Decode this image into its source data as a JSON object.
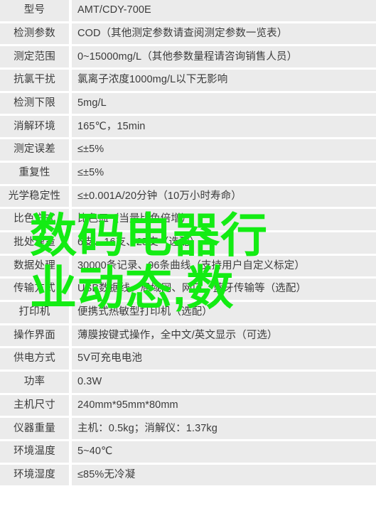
{
  "table": {
    "rows": [
      {
        "label": "型号",
        "value": "AMT/CDY-700E"
      },
      {
        "label": "检测参数",
        "value": "COD（其他测定参数请查阅测定参数一览表）"
      },
      {
        "label": "测定范围",
        "value": "0~15000mg/L（其他参数量程请咨询销售人员）"
      },
      {
        "label": "抗氯干扰",
        "value": "氯离子浓度1000mg/L以下无影响"
      },
      {
        "label": "检测下限",
        "value": "5mg/L"
      },
      {
        "label": "消解环境",
        "value": "165℃，15min"
      },
      {
        "label": "测定误差",
        "value": "≤±5%"
      },
      {
        "label": "重复性",
        "value": "≤±5%"
      },
      {
        "label": "光学稳定性",
        "value": "≤±0.001A/20分钟（10万小时寿命）"
      },
      {
        "label": "比色方式",
        "value": "比色皿（当量比色倍增）"
      },
      {
        "label": "批处理量",
        "value": "6支、16支、25支（选配）"
      },
      {
        "label": "数据处理",
        "value": "30000条记录、96条曲线（支持用户自定义标定）"
      },
      {
        "label": "传输方式",
        "value": "USB数据线、局域网、网口、蓝牙传输等（选配）"
      },
      {
        "label": "打印机",
        "value": "便携式热敏型打印机（选配）"
      },
      {
        "label": "操作界面",
        "value": "薄膜按键式操作，全中文/英文显示（可选）"
      },
      {
        "label": "供电方式",
        "value": "5V可充电电池"
      },
      {
        "label": "功率",
        "value": "0.3W"
      },
      {
        "label": "主机尺寸",
        "value": "240mm*95mm*80mm"
      },
      {
        "label": "仪器重量",
        "value": "主机：0.5kg；消解仪：1.37kg"
      },
      {
        "label": "环境温度",
        "value": "5~40℃"
      },
      {
        "label": "环境湿度",
        "value": "≤85%无冷凝"
      }
    ]
  },
  "watermark": {
    "color": "#13ec13",
    "line1": "数码电器行",
    "line2": "业动态,数"
  }
}
